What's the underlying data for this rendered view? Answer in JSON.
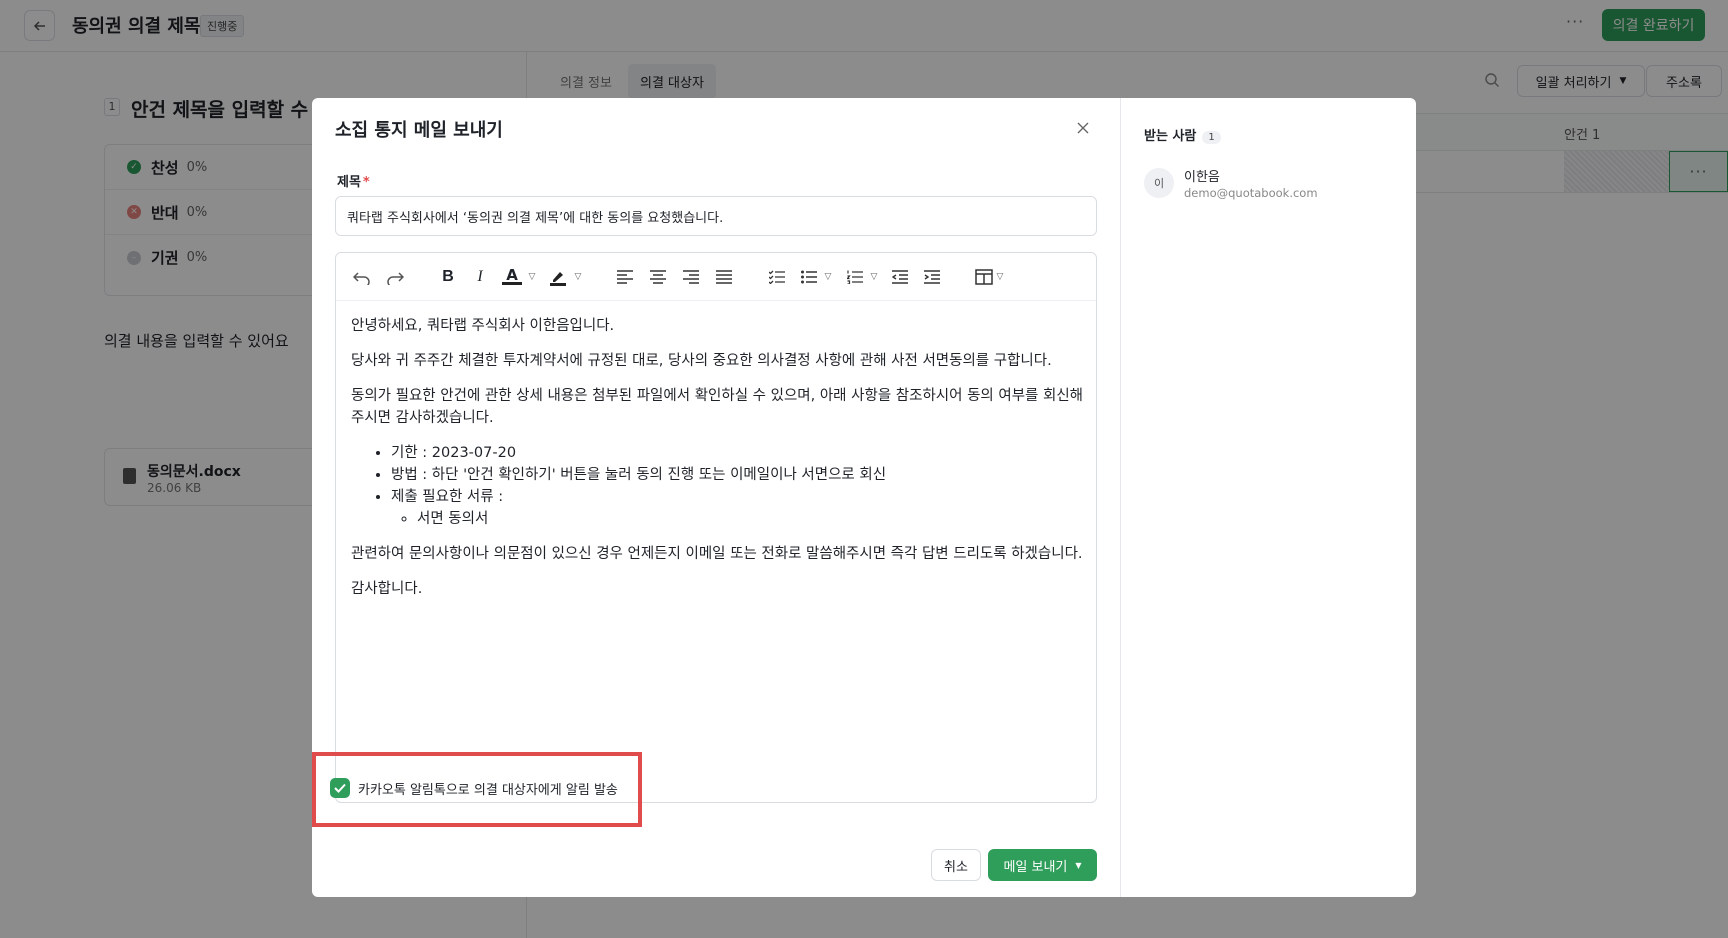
{
  "header": {
    "title": "동의권 의결 제목",
    "status": "진행중",
    "more": "···",
    "complete_label": "의결 완료하기"
  },
  "left": {
    "agenda_number": "1",
    "agenda_title": "안건 제목을 입력할 수 있",
    "votes": [
      {
        "label": "찬성",
        "pct": "0%",
        "color": "#2f9e5b",
        "mark": "✓"
      },
      {
        "label": "반대",
        "pct": "0%",
        "color": "#e8837e",
        "mark": "✕"
      },
      {
        "label": "기권",
        "pct": "0%",
        "color": "#c9ccd1",
        "mark": "–"
      }
    ],
    "content": "의결 내용을 입력할 수 있어요",
    "file": {
      "name": "동의문서.docx",
      "size": "26.06 KB"
    }
  },
  "right": {
    "tabs": [
      "의결 정보",
      "의결 대상자"
    ],
    "bulk_label": "일괄 처리하기",
    "address_label": "주소록",
    "column": "안건 1",
    "row_more": "···"
  },
  "modal": {
    "title": "소집 통지 메일 보내기",
    "subject_label": "제목",
    "required": "*",
    "subject_value": "쿼타랩 주식회사에서 ‘동의권 의결 제목’에 대한 동의를 요청했습니다.",
    "body": {
      "greeting": "안녕하세요, 쿼타랩 주식회사 이한음입니다.",
      "p1": "당사와 귀 주주간 체결한 투자계약서에 규정된 대로, 당사의 중요한 의사결정 사항에 관해 사전 서면동의를 구합니다.",
      "p2": "동의가 필요한 안건에 관한 상세 내용은 첨부된 파일에서 확인하실 수 있으며, 아래 사항을 참조하시어 동의 여부를 회신해주시면 감사하겠습니다.",
      "bullets": [
        "기한 : 2023-07-20",
        "방법 : 하단 '안건 확인하기' 버튼을 눌러 동의 진행 또는 이메일이나 서면으로 회신",
        "제출 필요한 서류 :"
      ],
      "sub_bullet": "서면 동의서",
      "p3": "관련하여 문의사항이나 의문점이 있으신 경우 언제든지 이메일 또는 전화로 말씀해주시면 즉각 답변 드리도록 하겠습니다.",
      "closing": "감사합니다."
    },
    "kakao_label": "카카오톡 알림톡으로 의결 대상자에게 알림 발송",
    "cancel_label": "취소",
    "send_label": "메일 보내기",
    "recipients": {
      "title": "받는 사람",
      "count": "1",
      "items": [
        {
          "initial": "이",
          "name": "이한음",
          "email": "demo@quotabook.com"
        }
      ]
    }
  },
  "colors": {
    "accent": "#2f9e5b",
    "highlight": "#e04b4b"
  }
}
